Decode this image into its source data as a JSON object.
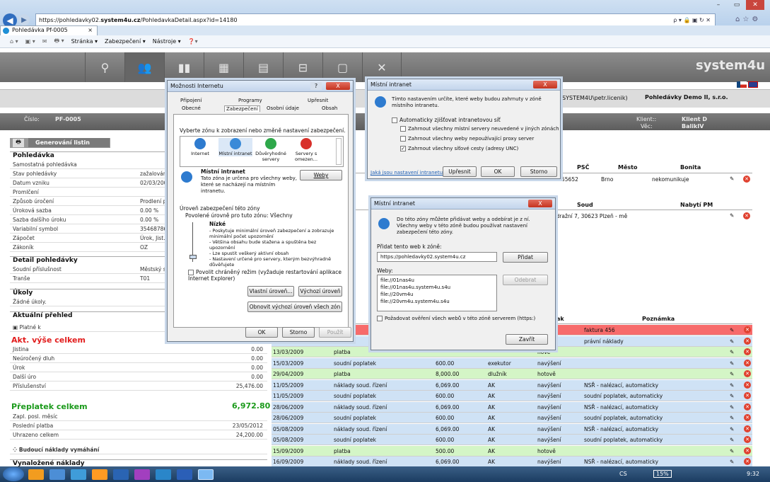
{
  "browser": {
    "url_prefix": "https://pohledavky02.",
    "url_domain": "system4u.cz",
    "url_rest": "/PohledavkaDetail.aspx?id=14180",
    "addr_tools": "ρ ▾ 🔒 ▣ ↻ ✕",
    "tab_title": "Pohledávka Pf-0005",
    "cmd": {
      "stranka": "Stránka ▾",
      "zabezpeceni": "Zabezpečení ▾",
      "nastroje": "Nástroje ▾"
    }
  },
  "app": {
    "logo": "system4u",
    "user": "nik(SYSTEM4U\\petr.licenik)",
    "company": "Pohledávky Demo II, s.r.o.",
    "cislo_label": "Číslo:",
    "cislo": "PF-0005",
    "klient_label": "Klient::",
    "klient": "Klient D",
    "vec_label": "Věc:",
    "vec": "BalikIV",
    "gen_listin": "Generování listin"
  },
  "left": {
    "pohledavka": "Pohledávka",
    "rows1": [
      {
        "k": "Samostatná pohledávka",
        "v": ""
      },
      {
        "k": "Stav pohledávky",
        "v": "zažalován"
      },
      {
        "k": "Datum vzniku",
        "v": "02/03/200"
      },
      {
        "k": "Promlčení",
        "v": ""
      },
      {
        "k": "Způsob úročení",
        "v": "Prodlení p"
      },
      {
        "k": "Úroková sazba",
        "v": "0.00 %"
      },
      {
        "k": "Sazba dalšího úroku",
        "v": "0.00 %"
      },
      {
        "k": "Variabilní symbol",
        "v": "35468786"
      },
      {
        "k": "Zápočet",
        "v": "Úrok, Jist."
      },
      {
        "k": "Zákoník",
        "v": "OZ"
      }
    ],
    "detail": "Detail pohledávky",
    "rows2": [
      {
        "k": "Soudní příslušnost",
        "v": "Městský s"
      },
      {
        "k": "Tranše",
        "v": "T01"
      }
    ],
    "ukoly": "Úkoly",
    "zadne_ukoly": "Žádné úkoly.",
    "aktualni": "Aktuální přehled",
    "platne_k": "Platné k",
    "akt_vyse": "Akt. výše celkem",
    "rows3": [
      {
        "k": "Jistina",
        "r": "0.00"
      },
      {
        "k": "Neúročený dluh",
        "r": "0.00"
      },
      {
        "k": "Úrok",
        "r": "0.00"
      },
      {
        "k": "Další úro",
        "r": "0.00"
      },
      {
        "k": "Příslušenství",
        "r": "25,476.00"
      }
    ],
    "preplatek": "Přeplatek celkem",
    "preplatek_v": "6,972.80",
    "rows4": [
      {
        "k": "Zapl. posl. měsíc",
        "r": ""
      },
      {
        "k": "Poslední platba",
        "r": "23/05/2012"
      },
      {
        "k": "Uhrazeno celkem",
        "r": "24,200.00"
      }
    ],
    "budouci": "Budoucí náklady vymáhání",
    "vynalozene": "Vynaložené náklady"
  },
  "right": {
    "hdr1": {
      "psc": "PSČ",
      "mesto": "Město",
      "bonita": "Bonita",
      "psc_v": "55652",
      "mesto_v": "Brno",
      "bonita_v": "nekomunikuje"
    },
    "hdr2": {
      "soud": "Soud",
      "nabyti": "Nabytí PM",
      "soud_v": "to, Nádražní 7, 30623 Plzeň - mě"
    },
    "hdr3": {
      "jak": "Jak",
      "poznamka": "Poznámka"
    },
    "rows": [
      {
        "d": "",
        "t": "",
        "a": "",
        "w": "",
        "j": "hově",
        "n": "faktura 456",
        "c": "r"
      },
      {
        "d": "",
        "t": "soud",
        "a": "",
        "w": "",
        "j": "šení",
        "n": "právní náklady",
        "c": "b"
      },
      {
        "d": "13/03/2009",
        "t": "platba",
        "a": "",
        "w": "",
        "j": "hově",
        "n": "",
        "c": "g"
      },
      {
        "d": "15/03/2009",
        "t": "soudní poplatek",
        "a": "600.00",
        "w": "exekutor",
        "j": "navýšení",
        "n": "",
        "c": "b"
      },
      {
        "d": "29/04/2009",
        "t": "platba",
        "a": "8,000.00",
        "w": "dlužník",
        "j": "hotově",
        "n": "",
        "c": "g"
      },
      {
        "d": "11/05/2009",
        "t": "náklady soud. řízení",
        "a": "6,069.00",
        "w": "AK",
        "j": "navýšení",
        "n": "NSŘ - nalézací, automaticky",
        "c": "b"
      },
      {
        "d": "11/05/2009",
        "t": "soudní poplatek",
        "a": "600.00",
        "w": "AK",
        "j": "navýšení",
        "n": "soudní poplatek, automaticky",
        "c": "b"
      },
      {
        "d": "28/06/2009",
        "t": "náklady soud. řízení",
        "a": "6,069.00",
        "w": "AK",
        "j": "navýšení",
        "n": "NSŘ - nalézací, automaticky",
        "c": "b"
      },
      {
        "d": "28/06/2009",
        "t": "soudní poplatek",
        "a": "600.00",
        "w": "AK",
        "j": "navýšení",
        "n": "soudní poplatek, automaticky",
        "c": "b"
      },
      {
        "d": "05/08/2009",
        "t": "náklady soud. řízení",
        "a": "6,069.00",
        "w": "AK",
        "j": "navýšení",
        "n": "NSŘ - nalézací, automaticky",
        "c": "b"
      },
      {
        "d": "05/08/2009",
        "t": "soudní poplatek",
        "a": "600.00",
        "w": "AK",
        "j": "navýšení",
        "n": "soudní poplatek, automaticky",
        "c": "b"
      },
      {
        "d": "15/09/2009",
        "t": "platba",
        "a": "500.00",
        "w": "AK",
        "j": "hotově",
        "n": "",
        "c": "g"
      },
      {
        "d": "16/09/2009",
        "t": "náklady soud. řízení",
        "a": "6,069.00",
        "w": "AK",
        "j": "navýšení",
        "n": "NSŘ - nalézací, automaticky",
        "c": "b"
      }
    ]
  },
  "dlg_internet": {
    "title": "Možnosti Internetu",
    "q": "?",
    "close": "X",
    "tabs_top": [
      "Připojení",
      "Programy",
      "Upřesnit"
    ],
    "tabs_bottom": [
      "Obecné",
      "Zabezpečení",
      "Osobní údaje",
      "Obsah"
    ],
    "zone_prompt": "Vyberte zónu k zobrazení nebo změně nastavení zabezpečení.",
    "zones": [
      "Internet",
      "Místní intranet",
      "Důvěryhodné servery",
      "Servery s omezen..."
    ],
    "zone_title": "Místní intranet",
    "zone_desc": "Tato zóna je určena pro všechny weby, které se nacházejí na místním intranetu.",
    "weby_btn": "Weby",
    "level_group": "Úroveň zabezpečení této zóny",
    "allowed": "Povolené úrovně pro tuto zónu: Všechny",
    "level_name": "Nízké",
    "level_lines": [
      "- Poskytuje minimální úroveň zabezpečení a zobrazuje minimální počet upozornění",
      "- Většina obsahu bude stažena a spuštěna bez upozornění",
      "- Lze spustit veškerý aktivní obsah",
      "- Nastavení určené pro servery, kterým bezvýhradně důvěřujete"
    ],
    "protected": "Povolit chráněný režim (vyžaduje restartování aplikace Internet Explorer)",
    "vlastni": "Vlastní úroveň...",
    "vychozi": "Výchozí úroveň",
    "obnovit": "Obnovit výchozí úroveň všech zón",
    "ok": "OK",
    "storno": "Storno",
    "pouzit": "Použít"
  },
  "dlg_intranet1": {
    "title": "Místní intranet",
    "close": "X",
    "desc": "Tímto nastavením určíte, které weby budou zahrnuty v zóně místního intranetu.",
    "auto": "Automaticky zjišťovat intranetovou síť",
    "opt1": "Zahrnout všechny místní servery neuvedené v jiných zónách",
    "opt2": "Zahrnout všechny weby nepoužívající proxy server",
    "opt3": "Zahrnout všechny síťové cesty (adresy UNC)",
    "link": "Jaká jsou nastavení intranetu?",
    "upresnit": "Upřesnit",
    "ok": "OK",
    "storno": "Storno"
  },
  "dlg_intranet2": {
    "title": "Místní intranet",
    "close": "X",
    "desc": "Do této zóny můžete přidávat weby a odebírat je z ní. Všechny weby v této zóně budou používat nastavení zabezpečení této zóny.",
    "add_label": "Přidat tento web k zóně:",
    "add_value": "https://pohledavky02.system4u.cz",
    "pridat": "Přidat",
    "weby_label": "Weby:",
    "sites": [
      "file://01nas4u",
      "file://01nas4u.system4u.s4u",
      "file://20vm4u",
      "file://20vm4u.system4u.s4u"
    ],
    "odebrat": "Odebrat",
    "require": "Požadovat ověření všech webů v této zóně serverem (https:)",
    "zavrit": "Zavřít"
  },
  "taskbar": {
    "lang": "CS",
    "zoom": "15%",
    "time": "9:32"
  }
}
